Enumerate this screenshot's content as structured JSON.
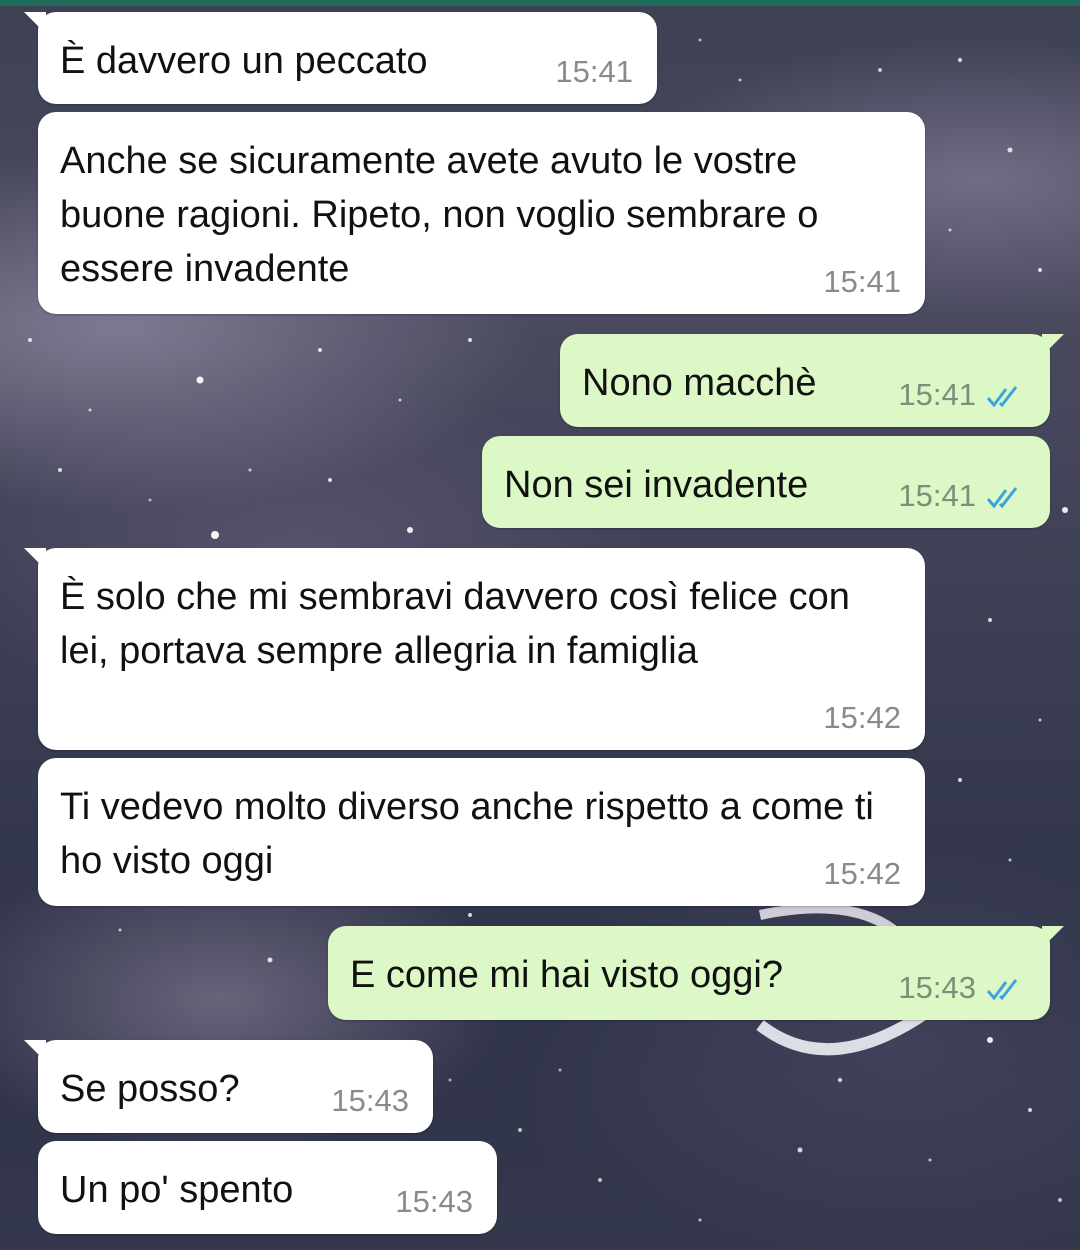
{
  "colors": {
    "incoming_bubble": "#ffffff",
    "outgoing_bubble": "#dcf8c6",
    "read_ticks": "#3aa3e0",
    "header_bar": "#1f6b5c"
  },
  "messages": [
    {
      "direction": "incoming",
      "text": "È davvero un peccato",
      "time": "15:41"
    },
    {
      "direction": "incoming",
      "text": "Anche se sicuramente avete avuto le vostre buone ragioni. Ripeto, non voglio sembrare o essere invadente",
      "time": "15:41"
    },
    {
      "direction": "outgoing",
      "text": "Nono macchè",
      "time": "15:41",
      "status": "read"
    },
    {
      "direction": "outgoing",
      "text": "Non sei invadente",
      "time": "15:41",
      "status": "read"
    },
    {
      "direction": "incoming",
      "text": "È solo che mi sembravi davvero così felice con lei, portava sempre allegria in famiglia",
      "time": "15:42"
    },
    {
      "direction": "incoming",
      "text": "Ti vedevo molto diverso anche rispetto a come ti ho visto oggi",
      "time": "15:42"
    },
    {
      "direction": "outgoing",
      "text": "E come mi hai visto oggi?",
      "time": "15:43",
      "status": "read"
    },
    {
      "direction": "incoming",
      "text": "Se posso?",
      "time": "15:43"
    },
    {
      "direction": "incoming",
      "text": "Un po' spento",
      "time": "15:43"
    }
  ]
}
